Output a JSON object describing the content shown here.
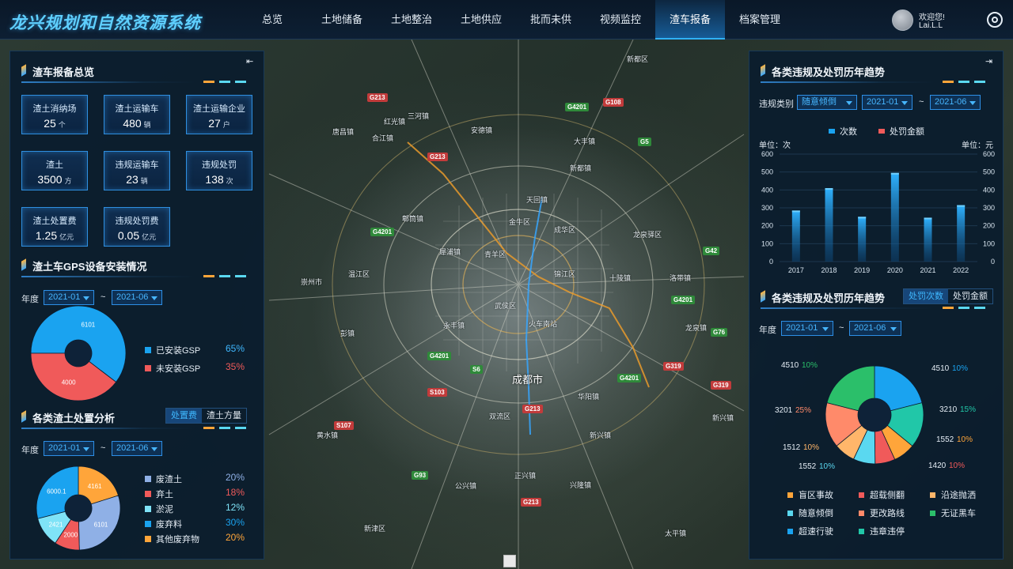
{
  "header": {
    "title": "龙兴规划和自然资源系统",
    "nav": [
      "总览",
      "土地储备",
      "土地整治",
      "土地供应",
      "批而未供",
      "视频监控",
      "渣车报备",
      "档案管理"
    ],
    "active_nav": "渣车报备",
    "user_greeting": "欢迎您!",
    "user_name": "Lai.L.L",
    "settings_icon": "gear-icon"
  },
  "colors": {
    "accent": "#2fb2ff",
    "orange": "#ffa53a",
    "red": "#f05a5a",
    "blue": "#1aa3f0",
    "cyan": "#5ad8f0"
  },
  "overview": {
    "title": "渣车报备总览",
    "stats": [
      {
        "label": "渣土消纳场",
        "value": "25",
        "unit": "个"
      },
      {
        "label": "渣土运输车",
        "value": "480",
        "unit": "辆"
      },
      {
        "label": "渣土运输企业",
        "value": "27",
        "unit": "户"
      },
      {
        "label": "渣土",
        "value": "3500",
        "unit": "方"
      },
      {
        "label": "违规运输车",
        "value": "23",
        "unit": "辆"
      },
      {
        "label": "违规处罚",
        "value": "138",
        "unit": "次"
      },
      {
        "label": "渣土处置费",
        "value": "1.25",
        "unit": "亿元"
      },
      {
        "label": "违规处罚费",
        "value": "0.05",
        "unit": "亿元"
      }
    ]
  },
  "gps": {
    "title": "渣土车GPS设备安装情况",
    "filter_label": "年度",
    "from": "2021-01",
    "tilde": "~",
    "to": "2021-06",
    "slices": [
      {
        "name": "已安装GSP",
        "value": 6101,
        "pct": "65%",
        "color": "#1aa3f0"
      },
      {
        "name": "未安装GSP",
        "value": 4000,
        "pct": "35%",
        "color": "#f05a5a"
      }
    ]
  },
  "disposal": {
    "title": "各类渣土处置分析",
    "tabs": [
      "处置费",
      "渣土方量"
    ],
    "active_tab": "处置费",
    "filter_label": "年度",
    "from": "2021-01",
    "tilde": "~",
    "to": "2021-06",
    "slices": [
      {
        "name": "废渣土",
        "value": 6101,
        "label": "6101",
        "pct": "20%",
        "color": "#8fb0e6"
      },
      {
        "name": "弃土",
        "value": 2000,
        "label": "2000",
        "pct": "18%",
        "color": "#f05a5a"
      },
      {
        "name": "淤泥",
        "value": 2421,
        "label": "2421",
        "pct": "12%",
        "color": "#7fe3f7"
      },
      {
        "name": "废弃料",
        "value": 6000.1,
        "label": "6000.1",
        "pct": "30%",
        "color": "#1aa3f0"
      },
      {
        "name": "其他废弃物",
        "value": 4161,
        "label": "4161",
        "pct": "20%",
        "color": "#ffa53a"
      }
    ]
  },
  "trend": {
    "title": "各类违规及处罚历年趋势",
    "filter_label": "违规类别",
    "category": "随意倾倒",
    "from": "2021-01",
    "tilde": "~",
    "to": "2021-06",
    "legend": [
      "次数",
      "处罚金额"
    ],
    "left_unit": "单位：次",
    "right_unit": "单位：元"
  },
  "chart_data": [
    {
      "type": "bar",
      "title": "",
      "categories": [
        "2017",
        "2018",
        "2019",
        "2020",
        "2021",
        "2022"
      ],
      "series": [
        {
          "name": "次数",
          "values": [
            285,
            410,
            250,
            495,
            245,
            315
          ],
          "color": "#1aa3f0"
        },
        {
          "name": "处罚金额",
          "values": [],
          "color": "#f05a5a"
        }
      ],
      "ylim": [
        0,
        600
      ],
      "yticks": [
        "0",
        "100",
        "200",
        "300",
        "400",
        "500",
        "600"
      ],
      "ylabel": "单位：次",
      "y2label": "单位：元",
      "grid": true,
      "legend": "top"
    },
    {
      "type": "pie",
      "title": "",
      "slices": [
        {
          "value": 4510,
          "label": "4510",
          "pct": "10%",
          "color": "#1aa3f0"
        },
        {
          "value": 3210,
          "label": "3210",
          "pct": "15%",
          "color": "#21c7a8"
        },
        {
          "value": 1552,
          "label": "1552",
          "pct": "10%",
          "color": "#ffa53a"
        },
        {
          "value": 1420,
          "label": "1420",
          "pct": "10%",
          "color": "#f05a5a"
        },
        {
          "value": 1552,
          "label": "1552",
          "pct": "10%",
          "color": "#5ad8f0"
        },
        {
          "value": 1512,
          "label": "1512",
          "pct": "10%",
          "color": "#ffb66a"
        },
        {
          "value": 3201,
          "label": "3201",
          "pct": "25%",
          "color": "#ff8a6a"
        },
        {
          "value": 4510,
          "label": "4510",
          "pct": "10%",
          "color": "#2bbf6a"
        }
      ]
    }
  ],
  "trend2": {
    "title": "各类违规及处罚历年趋势",
    "tabs": [
      "处罚次数",
      "处罚金额"
    ],
    "active_tab": "处罚次数",
    "filter_label": "年度",
    "from": "2021-01",
    "tilde": "~",
    "to": "2021-06",
    "legend": [
      {
        "name": "盲区事故",
        "color": "#ffa53a"
      },
      {
        "name": "超载侧翻",
        "color": "#f05a5a"
      },
      {
        "name": "沿途抛洒",
        "color": "#ffb66a"
      },
      {
        "name": "随意倾倒",
        "color": "#5ad8f0"
      },
      {
        "name": "更改路线",
        "color": "#ff8a6a"
      },
      {
        "name": "无证黑车",
        "color": "#2bbf6a"
      },
      {
        "name": "超速行驶",
        "color": "#1aa3f0"
      },
      {
        "name": "违章违停",
        "color": "#21c7a8"
      }
    ]
  },
  "map": {
    "city": "成都市",
    "road_tags": [
      "G213",
      "G4201",
      "G108",
      "G5",
      "G213",
      "G4201",
      "G42",
      "G4201",
      "G76",
      "G319",
      "G4201",
      "G4201",
      "S6",
      "S103",
      "S107",
      "G93",
      "G213",
      "G319",
      "G213"
    ],
    "places": [
      "新都区",
      "安德镇",
      "唐昌镇",
      "三河镇",
      "大丰镇",
      "红光镇",
      "天回镇",
      "犀浦镇",
      "郫筒镇",
      "成华区",
      "龙泉驿区",
      "锦江区",
      "武侯区",
      "青羊区",
      "金牛区",
      "双流区",
      "新津区",
      "温江区",
      "崇州市",
      "华阳镇",
      "彭镇",
      "黄水镇",
      "新兴镇",
      "太平镇",
      "洛带镇",
      "十陵镇",
      "龙泉镇",
      "永丰镇",
      "火车南站",
      "兴隆镇",
      "正兴镇",
      "公兴镇",
      "新兴镇",
      "合江镇",
      "新都镇"
    ]
  }
}
